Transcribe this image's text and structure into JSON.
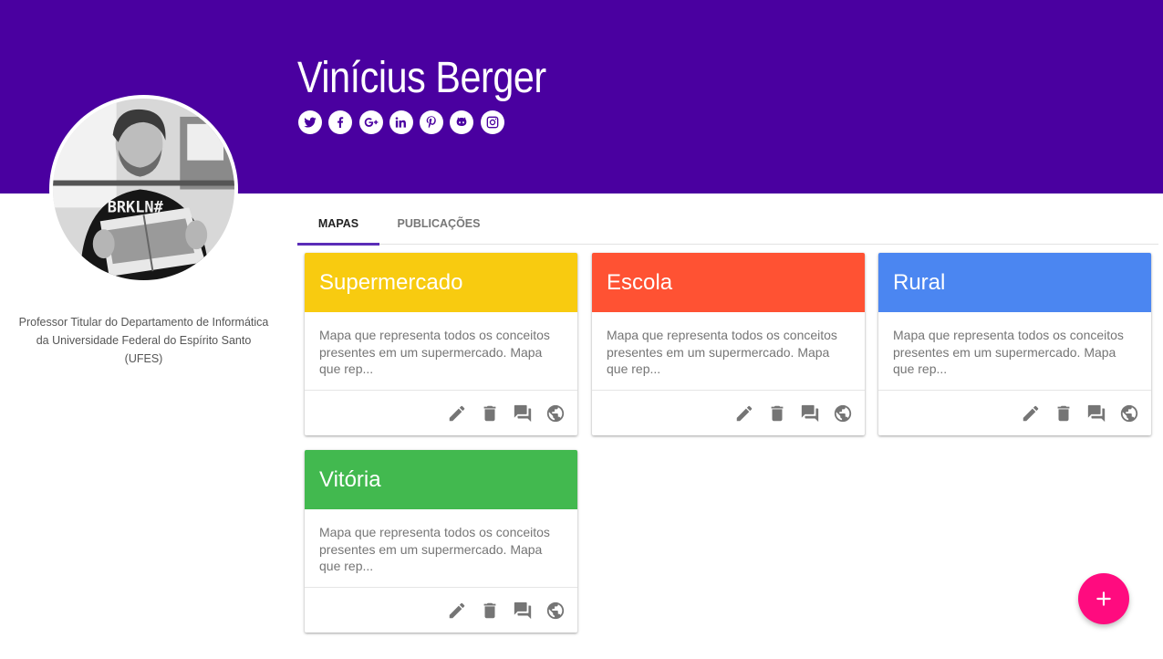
{
  "profile": {
    "name": "Vinícius Berger",
    "bio": "Professor Titular do Departamento de Informática da Universidade Federal do Espírito Santo (UFES)",
    "avatar_shirt_text": "BRKLN#",
    "social_icons": [
      "twitter-icon",
      "facebook-icon",
      "google-plus-icon",
      "linkedin-icon",
      "pinterest-icon",
      "github-icon",
      "instagram-icon"
    ]
  },
  "tabs": [
    {
      "label": "MAPAS",
      "active": true
    },
    {
      "label": "PUBLICAÇÕES",
      "active": false
    }
  ],
  "cards": [
    {
      "title": "Supermercado",
      "description": "Mapa que representa todos os conceitos presentes em um supermercado. Mapa que rep...",
      "color": "#f8cb10"
    },
    {
      "title": "Escola",
      "description": "Mapa que representa todos os conceitos presentes em um supermercado. Mapa que rep...",
      "color": "#ff5233"
    },
    {
      "title": "Rural",
      "description": "Mapa que representa todos os conceitos presentes em um supermercado. Mapa que rep...",
      "color": "#4b86f1"
    },
    {
      "title": "Vitória",
      "description": "Mapa que representa todos os conceitos presentes em um supermercado. Mapa que rep...",
      "color": "#42b94f"
    }
  ],
  "card_action_icons": [
    "edit-icon",
    "delete-icon",
    "comments-icon",
    "globe-icon"
  ],
  "colors": {
    "header": "#4a00a0",
    "tab_indicator": "#5b2db8",
    "fab": "#ff0b7f",
    "action_icon": "#757575"
  },
  "fab": {
    "icon": "plus-icon"
  }
}
